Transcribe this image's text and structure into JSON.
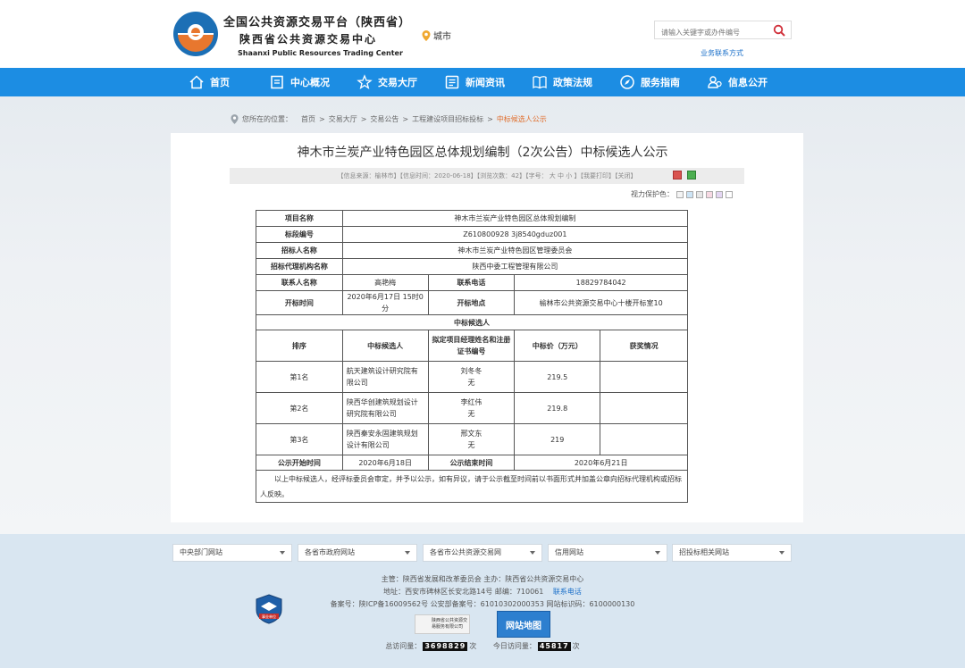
{
  "header": {
    "title_cn": "全国公共资源交易平台（陕西省）",
    "subtitle_cn": "陕西省公共资源交易中心",
    "title_en": "Shaanxi Public Resources Trading Center",
    "city_label": "城市",
    "search_placeholder": "请输入关键字或办件编号",
    "contact_link": "业务联系方式"
  },
  "nav": {
    "items": [
      {
        "label": "首页",
        "icon": "home-icon"
      },
      {
        "label": "中心概况",
        "icon": "document-icon"
      },
      {
        "label": "交易大厅",
        "icon": "star-icon"
      },
      {
        "label": "新闻资讯",
        "icon": "news-icon"
      },
      {
        "label": "政策法规",
        "icon": "book-icon"
      },
      {
        "label": "服务指南",
        "icon": "compass-icon"
      },
      {
        "label": "信息公开",
        "icon": "info-icon"
      }
    ]
  },
  "breadcrumb": {
    "prefix": "您所在的位置：",
    "items": [
      "首页",
      "交易大厅",
      "交易公告",
      "工程建设项目招标投标"
    ],
    "current": "中标候选人公示",
    "sep": ">"
  },
  "article": {
    "title": "神木市兰炭产业特色园区总体规划编制（2次公告）中标候选人公示",
    "meta": "【信息来源：榆林市】【信息时间：2020-06-18】【浏览次数：42】【字号： 大 中 小 】【我要打印】【关闭】",
    "vision_label": "视力保护色："
  },
  "colors": {
    "nav_bg": "#1c8de3",
    "accent_orange": "#e06d2a",
    "footer_bg": "#d9e6f1"
  },
  "table": {
    "project_name_label": "项目名称",
    "project_name": "神木市兰炭产业特色园区总体规划编制",
    "section_no_label": "标段编号",
    "section_no": "Z610800928 3j8540gduz001",
    "tenderer_label": "招标人名称",
    "tenderer": "神木市兰炭产业特色园区管理委员会",
    "agency_label": "招标代理机构名称",
    "agency": "陕西中委工程管理有限公司",
    "contact_label": "联系人名称",
    "contact": "高艳梅",
    "phone_label": "联系电话",
    "phone": "18829784042",
    "open_time_label": "开标时间",
    "open_time": "2020年6月17日 15时0分",
    "open_place_label": "开标地点",
    "open_place": "榆林市公共资源交易中心十楼开标室10",
    "candidates_heading": "中标候选人",
    "col_rank": "排序",
    "col_candidate": "中标候选人",
    "col_manager": "拟定项目经理姓名和注册证书编号",
    "col_price": "中标价（万元）",
    "col_awards": "获奖情况",
    "rows": [
      {
        "rank": "第1名",
        "candidate": "航天建筑设计研究院有限公司",
        "manager": "刘冬冬",
        "cert": "无",
        "price": "219.5",
        "awards": ""
      },
      {
        "rank": "第2名",
        "candidate": "陕西华创建筑规划设计研究院有限公司",
        "manager": "李红伟",
        "cert": "无",
        "price": "219.8",
        "awards": ""
      },
      {
        "rank": "第3名",
        "candidate": "陕西秦安永固建筑规划设计有限公司",
        "manager": "邢文东",
        "cert": "无",
        "price": "219",
        "awards": ""
      }
    ],
    "pub_start_label": "公示开始时间",
    "pub_start": "2020年6月18日",
    "pub_end_label": "公示结束时间",
    "pub_end": "2020年6月21日",
    "notice": "以上中标候选人，经评标委员会审定，并予以公示，如有异议，请于公示截至时间前以书面形式并加盖公章向招标代理机构或招标人反映。"
  },
  "footer": {
    "selects": [
      "中央部门网站",
      "各省市政府网站",
      "各省市公共资源交易网",
      "信用网站",
      "招投标相关网站"
    ],
    "line1": "主管：陕西省发展和改革委员会    主办：陕西省公共资源交易中心",
    "line2_prefix": "地址：西安市碑林区长安北路14号    邮编：710061",
    "line2_link": "联系电话",
    "line3": "备案号：陕ICP备16009562号    公安部备案号：61010302000353    网站标识码：6100000130",
    "logo1_text": "陕西省公共资源交易服务有限公司",
    "logo2_text": "网站地图",
    "badge_text": "事业单位",
    "total_visits_label": "总访问量：",
    "total_visits": "3698829",
    "today_visits_label": "今日访问量：",
    "today_visits": "45817",
    "unit": "次"
  }
}
